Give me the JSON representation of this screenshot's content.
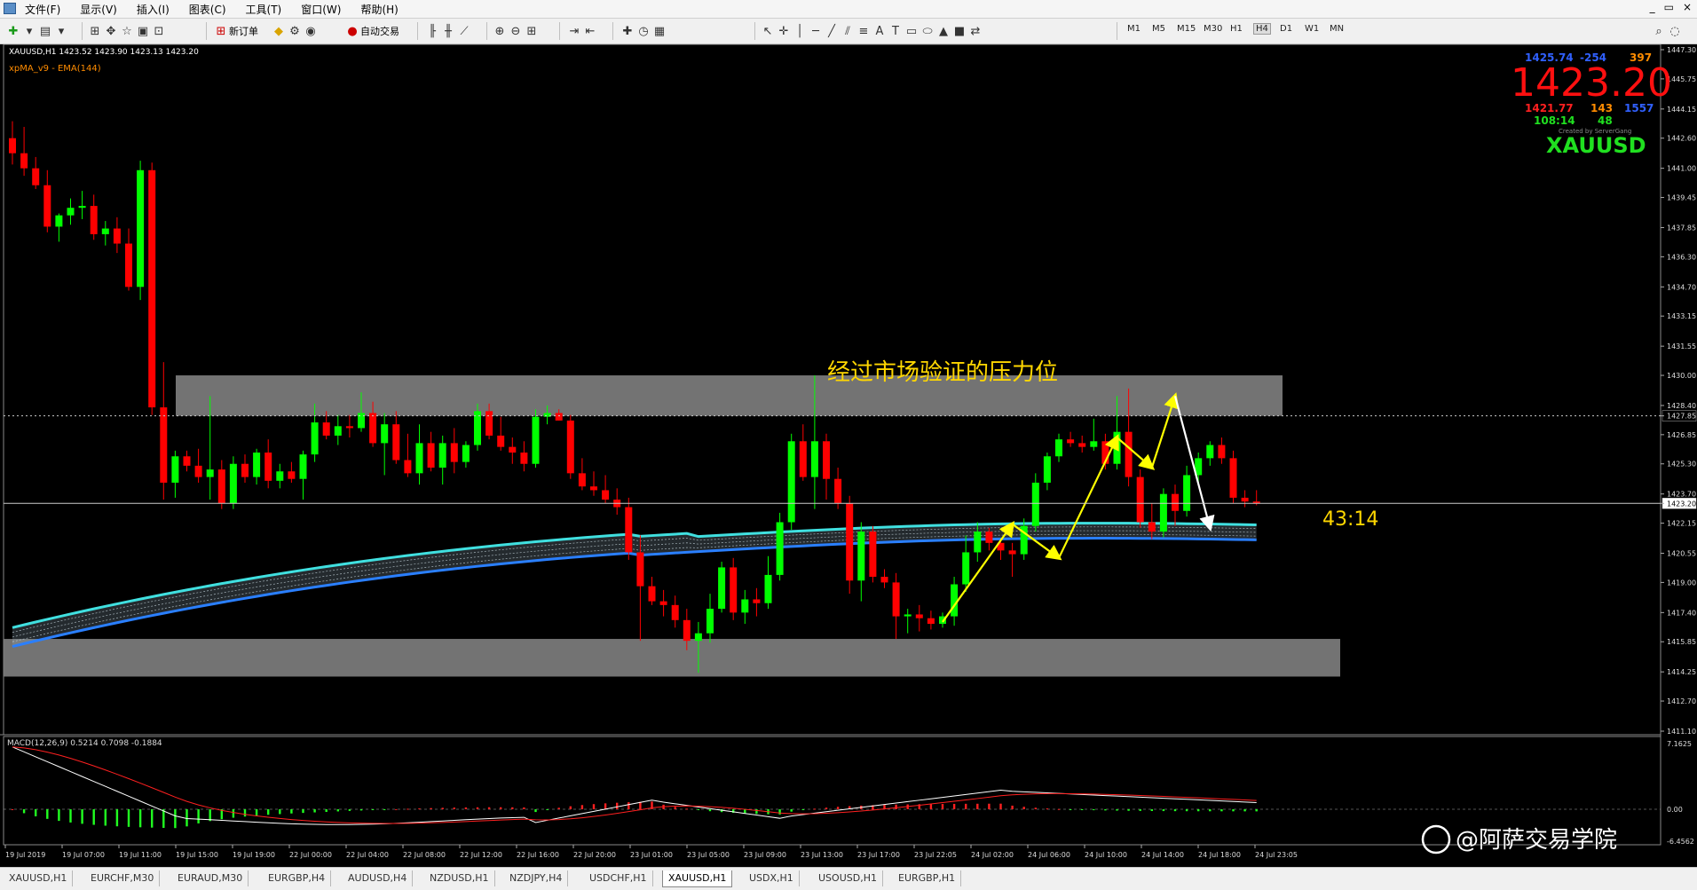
{
  "menu": [
    "文件(F)",
    "显示(V)",
    "插入(I)",
    "图表(C)",
    "工具(T)",
    "窗口(W)",
    "帮助(H)"
  ],
  "window_controls": [
    "_",
    "▭",
    "×"
  ],
  "toolbar": {
    "new_order": "新订单",
    "auto_trading": "自动交易",
    "timeframes": [
      "M1",
      "M5",
      "M15",
      "M30",
      "H1",
      "H4",
      "D1",
      "W1",
      "MN"
    ],
    "selected_timeframe": "H4"
  },
  "chart": {
    "symbol_header": "XAUUSD,H1  1423.52 1423.90 1423.13 1423.20",
    "indicator_label": "xpMA_v9 - EMA(144)",
    "price_axis": [
      "1447.30",
      "1445.75",
      "1444.15",
      "1442.60",
      "1441.00",
      "1439.45",
      "1437.85",
      "1436.30",
      "1434.70",
      "1433.15",
      "1431.55",
      "1430.00",
      "1428.40",
      "1427.85",
      "1426.85",
      "1425.30",
      "1423.70",
      "1423.20",
      "1422.15",
      "1420.55",
      "1419.00",
      "1417.40",
      "1415.85",
      "1414.25",
      "1412.70",
      "1411.10"
    ],
    "current_price_label": "1423.20",
    "dashed_level_label": "1427.85",
    "annotation": "经过市场验证的压力位",
    "countdown": "43:14",
    "macd_label": "MACD(12,26,9) 0.5214 0.7098 -0.1884",
    "macd_axis": [
      "7.1625",
      "0.00",
      "-6.4562"
    ],
    "time_axis": [
      "19 Jul 2019",
      "19 Jul 07:00",
      "19 Jul 11:00",
      "19 Jul 15:00",
      "19 Jul 19:00",
      "22 Jul 00:00",
      "22 Jul 04:00",
      "22 Jul 08:00",
      "22 Jul 12:00",
      "22 Jul 16:00",
      "22 Jul 20:00",
      "23 Jul 01:00",
      "23 Jul 05:00",
      "23 Jul 09:00",
      "23 Jul 13:00",
      "23 Jul 17:00",
      "23 Jul 22:05",
      "24 Jul 02:00",
      "24 Jul 06:00",
      "24 Jul 10:00",
      "24 Jul 14:00",
      "24 Jul 18:00",
      "24 Jul 23:05"
    ],
    "info_panel": {
      "top_left": "1425.74",
      "top_mid": "-254",
      "top_right": "397",
      "big_price": "1423.20",
      "row2_left": "1421.77",
      "row2_mid": "143",
      "row2_right": "1557",
      "row3_left": "108:14",
      "row3_mid": "48",
      "credit": "Created by ServerGang",
      "symbol": "XAUUSD"
    },
    "watermark": "@阿萨交易学院",
    "colors": {
      "bull": "#00ff00",
      "bear": "#ff0000",
      "ema_light": "#40e0e0",
      "ema_dark": "#2a7fff",
      "zone": "#808080",
      "annotation": "#ffd700",
      "arrow": "#ffff00"
    }
  },
  "chart_data": {
    "type": "candlestick",
    "symbol": "XAUUSD",
    "timeframe": "H1",
    "ohlc": [
      [
        1442.6,
        1443.5,
        1441.2,
        1441.8
      ],
      [
        1441.8,
        1443.2,
        1440.6,
        1441.0
      ],
      [
        1441.0,
        1441.6,
        1439.9,
        1440.1
      ],
      [
        1440.1,
        1440.9,
        1437.6,
        1437.9
      ],
      [
        1437.9,
        1438.6,
        1437.1,
        1438.5
      ],
      [
        1438.5,
        1439.4,
        1438.0,
        1438.9
      ],
      [
        1438.9,
        1439.8,
        1438.3,
        1439.0
      ],
      [
        1439.0,
        1439.6,
        1437.2,
        1437.5
      ],
      [
        1437.5,
        1438.2,
        1436.9,
        1437.8
      ],
      [
        1437.8,
        1438.4,
        1436.5,
        1437.0
      ],
      [
        1437.0,
        1437.8,
        1434.5,
        1434.7
      ],
      [
        1434.7,
        1441.4,
        1434.0,
        1440.9
      ],
      [
        1440.9,
        1441.3,
        1427.9,
        1428.3
      ],
      [
        1428.3,
        1430.7,
        1423.4,
        1424.3
      ],
      [
        1424.3,
        1426.0,
        1423.5,
        1425.7
      ],
      [
        1425.7,
        1426.0,
        1424.9,
        1425.2
      ],
      [
        1425.2,
        1426.1,
        1424.3,
        1424.6
      ],
      [
        1424.6,
        1428.9,
        1423.4,
        1425.0
      ],
      [
        1425.0,
        1425.5,
        1422.9,
        1423.2
      ],
      [
        1423.2,
        1425.7,
        1422.9,
        1425.3
      ],
      [
        1425.3,
        1425.8,
        1424.3,
        1424.6
      ],
      [
        1424.6,
        1426.1,
        1424.2,
        1425.9
      ],
      [
        1425.9,
        1426.6,
        1424.0,
        1424.4
      ],
      [
        1424.4,
        1425.3,
        1424.0,
        1424.9
      ],
      [
        1424.9,
        1425.4,
        1424.3,
        1424.5
      ],
      [
        1424.5,
        1426.0,
        1423.4,
        1425.8
      ],
      [
        1425.8,
        1428.5,
        1425.4,
        1427.5
      ],
      [
        1427.5,
        1428.1,
        1426.6,
        1426.8
      ],
      [
        1426.8,
        1427.9,
        1426.3,
        1427.3
      ],
      [
        1427.3,
        1427.9,
        1426.7,
        1427.2
      ],
      [
        1427.2,
        1429.1,
        1427.0,
        1428.0
      ],
      [
        1428.0,
        1428.6,
        1426.2,
        1426.4
      ],
      [
        1426.4,
        1428.0,
        1424.7,
        1427.4
      ],
      [
        1427.4,
        1428.1,
        1425.3,
        1425.5
      ],
      [
        1425.5,
        1426.9,
        1424.6,
        1424.8
      ],
      [
        1424.8,
        1427.4,
        1424.2,
        1426.4
      ],
      [
        1426.4,
        1427.0,
        1424.9,
        1425.1
      ],
      [
        1425.1,
        1426.8,
        1424.2,
        1426.4
      ],
      [
        1426.4,
        1427.2,
        1424.8,
        1425.4
      ],
      [
        1425.4,
        1426.5,
        1425.1,
        1426.3
      ],
      [
        1426.3,
        1428.5,
        1426.0,
        1428.1
      ],
      [
        1428.1,
        1428.5,
        1426.6,
        1426.8
      ],
      [
        1426.8,
        1427.8,
        1426.0,
        1426.2
      ],
      [
        1426.2,
        1426.7,
        1425.3,
        1425.9
      ],
      [
        1425.9,
        1426.5,
        1424.9,
        1425.3
      ],
      [
        1425.3,
        1428.2,
        1425.1,
        1427.8
      ],
      [
        1427.8,
        1428.4,
        1427.4,
        1428.0
      ],
      [
        1428.0,
        1428.2,
        1427.6,
        1427.6
      ],
      [
        1427.6,
        1427.9,
        1424.5,
        1424.8
      ],
      [
        1424.8,
        1425.6,
        1423.9,
        1424.1
      ],
      [
        1424.1,
        1424.9,
        1423.6,
        1423.9
      ],
      [
        1423.9,
        1424.7,
        1423.2,
        1423.4
      ],
      [
        1423.4,
        1424.0,
        1422.6,
        1423.0
      ],
      [
        1423.0,
        1423.5,
        1420.2,
        1420.6
      ],
      [
        1420.6,
        1421.5,
        1415.9,
        1418.8
      ],
      [
        1418.8,
        1419.3,
        1417.8,
        1418.0
      ],
      [
        1418.0,
        1418.6,
        1417.2,
        1417.8
      ],
      [
        1417.8,
        1418.3,
        1416.6,
        1417.0
      ],
      [
        1417.0,
        1417.6,
        1415.4,
        1415.9
      ],
      [
        1415.9,
        1416.9,
        1414.2,
        1416.3
      ],
      [
        1416.3,
        1418.4,
        1415.8,
        1417.6
      ],
      [
        1417.6,
        1420.1,
        1417.4,
        1419.8
      ],
      [
        1419.8,
        1420.3,
        1417.0,
        1417.4
      ],
      [
        1417.4,
        1418.6,
        1416.8,
        1418.1
      ],
      [
        1418.1,
        1418.7,
        1417.2,
        1417.9
      ],
      [
        1417.9,
        1420.4,
        1417.6,
        1419.4
      ],
      [
        1419.4,
        1422.7,
        1419.1,
        1422.2
      ],
      [
        1422.2,
        1426.9,
        1421.8,
        1426.5
      ],
      [
        1426.5,
        1427.4,
        1424.4,
        1424.6
      ],
      [
        1424.6,
        1430.0,
        1422.9,
        1426.5
      ],
      [
        1426.5,
        1426.9,
        1423.4,
        1424.5
      ],
      [
        1424.5,
        1425.1,
        1422.9,
        1423.2
      ],
      [
        1423.2,
        1423.6,
        1418.4,
        1419.1
      ],
      [
        1419.1,
        1422.2,
        1418.0,
        1421.7
      ],
      [
        1421.7,
        1422.0,
        1419.0,
        1419.3
      ],
      [
        1419.3,
        1419.7,
        1418.7,
        1419.0
      ],
      [
        1419.0,
        1419.5,
        1416.0,
        1417.2
      ],
      [
        1417.2,
        1417.6,
        1416.3,
        1417.3
      ],
      [
        1417.3,
        1417.8,
        1416.4,
        1417.1
      ],
      [
        1417.1,
        1417.5,
        1416.5,
        1416.8
      ],
      [
        1416.8,
        1417.4,
        1416.6,
        1417.2
      ],
      [
        1417.2,
        1419.3,
        1416.7,
        1418.9
      ],
      [
        1418.9,
        1421.5,
        1418.5,
        1420.6
      ],
      [
        1420.6,
        1422.2,
        1420.1,
        1421.7
      ],
      [
        1421.7,
        1421.9,
        1420.7,
        1421.1
      ],
      [
        1421.1,
        1421.3,
        1420.2,
        1420.7
      ],
      [
        1420.7,
        1421.1,
        1419.3,
        1420.5
      ],
      [
        1420.5,
        1422.4,
        1420.2,
        1422.0
      ],
      [
        1422.0,
        1424.8,
        1421.7,
        1424.3
      ],
      [
        1424.3,
        1425.9,
        1423.9,
        1425.7
      ],
      [
        1425.7,
        1426.9,
        1425.4,
        1426.6
      ],
      [
        1426.6,
        1427.0,
        1426.2,
        1426.4
      ],
      [
        1426.4,
        1426.8,
        1425.9,
        1426.2
      ],
      [
        1426.2,
        1427.7,
        1426.0,
        1426.5
      ],
      [
        1426.5,
        1426.9,
        1425.0,
        1425.3
      ],
      [
        1425.3,
        1428.9,
        1425.0,
        1427.0
      ],
      [
        1427.0,
        1429.3,
        1424.1,
        1424.6
      ],
      [
        1424.6,
        1425.0,
        1421.9,
        1422.2
      ],
      [
        1422.2,
        1423.2,
        1421.3,
        1421.7
      ],
      [
        1421.7,
        1424.0,
        1421.4,
        1423.7
      ],
      [
        1423.7,
        1424.2,
        1422.0,
        1422.8
      ],
      [
        1422.8,
        1425.2,
        1422.5,
        1424.7
      ],
      [
        1424.7,
        1425.9,
        1424.3,
        1425.6
      ],
      [
        1425.6,
        1426.5,
        1425.2,
        1426.3
      ],
      [
        1426.3,
        1426.7,
        1425.3,
        1425.6
      ],
      [
        1425.6,
        1426.0,
        1423.2,
        1423.5
      ],
      [
        1423.5,
        1423.9,
        1423.0,
        1423.3
      ],
      [
        1423.3,
        1423.9,
        1423.1,
        1423.2
      ]
    ],
    "ylim": [
      1411.1,
      1447.3
    ]
  }
}
